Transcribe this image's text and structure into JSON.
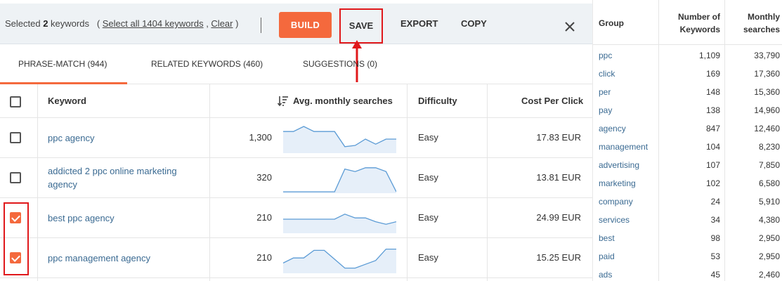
{
  "toolbar": {
    "selected_prefix": "Selected ",
    "selected_count": "2",
    "selected_suffix": " keywords",
    "paren_open": "( ",
    "select_all_label": "Select all 1404 keywords",
    "comma": " , ",
    "clear_label": "Clear",
    "paren_close": " )",
    "build_label": "BUILD",
    "save_label": "SAVE",
    "export_label": "EXPORT",
    "copy_label": "COPY"
  },
  "tabs": [
    {
      "label": "PHRASE-MATCH (944)",
      "active": true
    },
    {
      "label": "RELATED KEYWORDS (460)",
      "active": false
    },
    {
      "label": "SUGGESTIONS (0)",
      "active": false
    }
  ],
  "table": {
    "headers": {
      "keyword": "Keyword",
      "searches": "Avg. monthly searches",
      "difficulty": "Difficulty",
      "cpc": "Cost Per Click"
    },
    "rows": [
      {
        "keyword": "ppc agency",
        "searches": "1,300",
        "difficulty": "Easy",
        "cpc": "17.83 EUR",
        "checked": false,
        "trend": [
          0.8,
          0.8,
          1.0,
          0.8,
          0.8,
          0.8,
          0.2,
          0.25,
          0.5,
          0.3,
          0.5,
          0.5
        ]
      },
      {
        "keyword": "addicted 2 ppc online marketing agency",
        "searches": "320",
        "difficulty": "Easy",
        "cpc": "13.81 EUR",
        "checked": false,
        "trend": [
          0.0,
          0.0,
          0.0,
          0.0,
          0.0,
          0.0,
          0.9,
          0.8,
          0.95,
          0.95,
          0.8,
          0.0
        ]
      },
      {
        "keyword": "best ppc agency",
        "searches": "210",
        "difficulty": "Easy",
        "cpc": "24.99 EUR",
        "checked": true,
        "trend": [
          0.5,
          0.5,
          0.5,
          0.5,
          0.5,
          0.5,
          0.7,
          0.55,
          0.55,
          0.4,
          0.3,
          0.4
        ]
      },
      {
        "keyword": "ppc management agency",
        "searches": "210",
        "difficulty": "Easy",
        "cpc": "15.25 EUR",
        "checked": true,
        "trend": [
          0.35,
          0.55,
          0.55,
          0.85,
          0.85,
          0.5,
          0.15,
          0.15,
          0.3,
          0.45,
          0.9,
          0.9
        ]
      }
    ]
  },
  "groups": {
    "headers": {
      "group": "Group",
      "num_line1": "Number of",
      "num_line2": "Keywords",
      "monthly_line1": "Monthly",
      "monthly_line2": "searches"
    },
    "rows": [
      {
        "group": "ppc",
        "count": "1,109",
        "searches": "33,790"
      },
      {
        "group": "click",
        "count": "169",
        "searches": "17,360"
      },
      {
        "group": "per",
        "count": "148",
        "searches": "15,360"
      },
      {
        "group": "pay",
        "count": "138",
        "searches": "14,960"
      },
      {
        "group": "agency",
        "count": "847",
        "searches": "12,460"
      },
      {
        "group": "management",
        "count": "104",
        "searches": "8,230"
      },
      {
        "group": "advertising",
        "count": "107",
        "searches": "7,850"
      },
      {
        "group": "marketing",
        "count": "102",
        "searches": "6,580"
      },
      {
        "group": "company",
        "count": "24",
        "searches": "5,910"
      },
      {
        "group": "services",
        "count": "34",
        "searches": "4,380"
      },
      {
        "group": "best",
        "count": "98",
        "searches": "2,950"
      },
      {
        "group": "paid",
        "count": "53",
        "searches": "2,950"
      },
      {
        "group": "ads",
        "count": "45",
        "searches": "2,460"
      }
    ]
  },
  "colors": {
    "accent": "#f4693d",
    "link": "#3a6a92",
    "annotation_red": "#e0181b",
    "spark_line": "#5b9bd5",
    "spark_fill": "#e6eff9"
  }
}
